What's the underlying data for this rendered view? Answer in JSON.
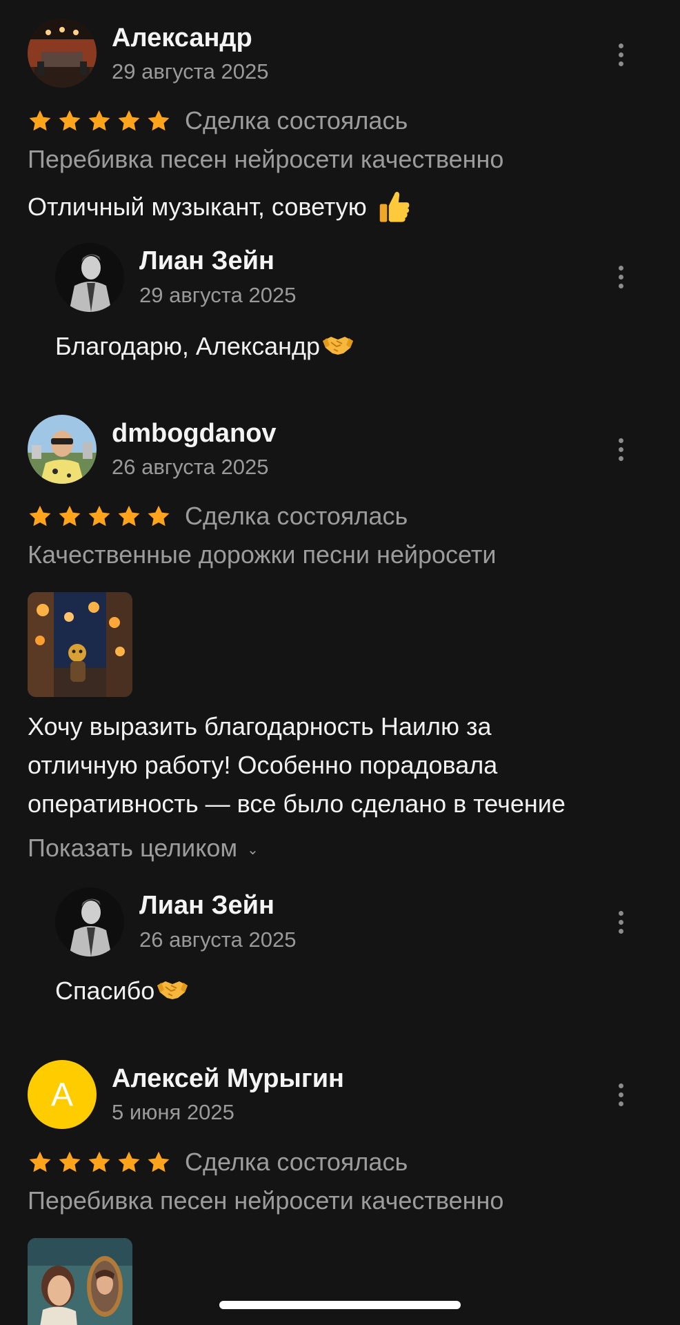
{
  "reviews": [
    {
      "author": "Александр",
      "date": "29 августа 2025",
      "rating": 5,
      "deal_status": "Сделка состоялась",
      "service": "Перебивка песен нейросети качественно",
      "text": "Отличный музыкант, советую",
      "emoji": "thumbs-up-icon",
      "reply": {
        "author": "Лиан Зейн",
        "date": "29 августа 2025",
        "text": "Благодарю, Александр",
        "emoji": "handshake-icon"
      }
    },
    {
      "author": "dmbogdanov",
      "date": "26 августа 2025",
      "rating": 5,
      "deal_status": "Сделка состоялась",
      "service": "Качественные дорожки песни нейросети",
      "text_lines": [
        "Хочу выразить благодарность Наилю за",
        "отличную работу! Особенно порадовала",
        "оперативность — все было сделано в течение"
      ],
      "show_more": "Показать целиком",
      "reply": {
        "author": "Лиан Зейн",
        "date": "26 августа 2025",
        "text": "Спасибо",
        "emoji": "handshake-icon"
      }
    },
    {
      "author": "Алексей Мурыгин",
      "avatar_letter": "А",
      "date": "5 июня 2025",
      "rating": 5,
      "deal_status": "Сделка состоялась",
      "service": "Перебивка песен нейросети качественно"
    }
  ],
  "colors": {
    "background": "#141414",
    "star": "#ffa41b",
    "muted_text": "#9c9c9c",
    "letter_avatar": "#ffcc00"
  }
}
